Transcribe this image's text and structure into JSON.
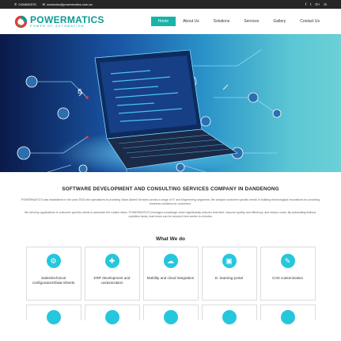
{
  "topbar": {
    "phone": "0434881575",
    "email": "contactus@powermatics.com.au",
    "social": [
      "facebook-icon",
      "twitter-icon",
      "google-plus-icon",
      "linkedin-icon"
    ]
  },
  "brand": {
    "name": "POWERMATICS",
    "tagline": "POWER OF AUTOMATION",
    "color": "#0b9a96"
  },
  "nav": {
    "items": [
      "Home",
      "About Us",
      "Solutions",
      "Services",
      "Gallery",
      "Contact Us"
    ],
    "active": "Home",
    "accent": "#18b4a9"
  },
  "intro": {
    "heading": "SOFTWARE DEVELOPMENT AND CONSULTING SERVICES COMPANY IN DANDENONG",
    "p1": "POWERMATICS was established in the year 2015 and specializes in providing Value Added Services across a range of IT and Engineering segments. We analyze customer specific needs in building technological innovations for providing business solutions for customers.",
    "p2": "We develop applications to customer specific needs to automate the routine tasks. POWERMATICS leverages knowledge which significantly reduces lead time, improve quality and efficiency, and reduce costs. By automating tedious, repetitive tasks, lead times can be reduced from weeks to minutes."
  },
  "services": {
    "title": "What We do",
    "items": [
      {
        "label": "Sales/technical configurators/Data-Sheets",
        "icon": "gear-icon"
      },
      {
        "label": "ERP development and customization",
        "icon": "puzzle-icon"
      },
      {
        "label": "Mobility and cloud integration",
        "icon": "cloud-icon"
      },
      {
        "label": "E- learning portal",
        "icon": "monitor-icon"
      },
      {
        "label": "CAD customization",
        "icon": "cad-icon"
      }
    ],
    "icon_color": "#25c7dc"
  }
}
